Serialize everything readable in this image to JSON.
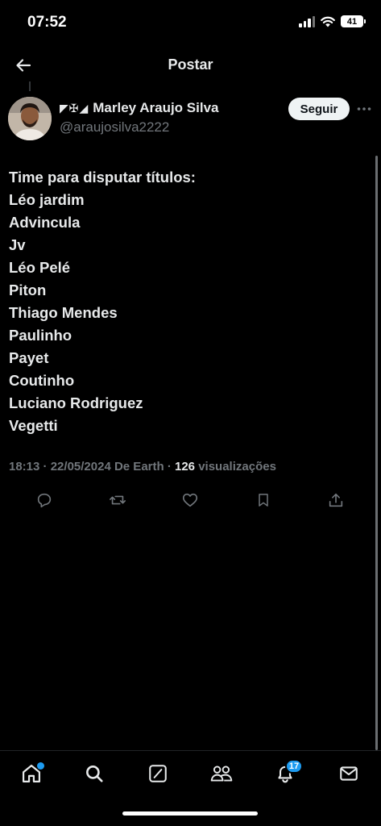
{
  "status": {
    "time": "07:52",
    "battery": "41"
  },
  "header": {
    "title": "Postar",
    "back_icon": "arrow-left-icon"
  },
  "author": {
    "flag_symbols": "◤✠◢",
    "name": "Marley Araujo Silva",
    "handle": "@araujosilva2222",
    "follow_label": "Seguir"
  },
  "post": {
    "lines": [
      "Time para disputar títulos:",
      "Léo jardim",
      "Advincula",
      "Jv",
      "Léo Pelé",
      "Piton",
      "Thiago Mendes",
      "Paulinho",
      "Payet",
      "Coutinho",
      "Luciano Rodriguez",
      "Vegetti"
    ],
    "time": "18:13",
    "date": "22/05/2024",
    "source": "De Earth",
    "views_count": "126",
    "views_label": "visualizações"
  },
  "actions": [
    "reply-icon",
    "repost-icon",
    "like-icon",
    "bookmark-icon",
    "share-icon"
  ],
  "tabbar": {
    "notifications_badge": "17",
    "items": [
      "home-icon",
      "search-icon",
      "compose-icon",
      "communities-icon",
      "notifications-icon",
      "messages-icon"
    ]
  },
  "colors": {
    "background": "#000000",
    "text": "#e7e9ea",
    "muted": "#71767b",
    "accent": "#1d9bf0"
  }
}
